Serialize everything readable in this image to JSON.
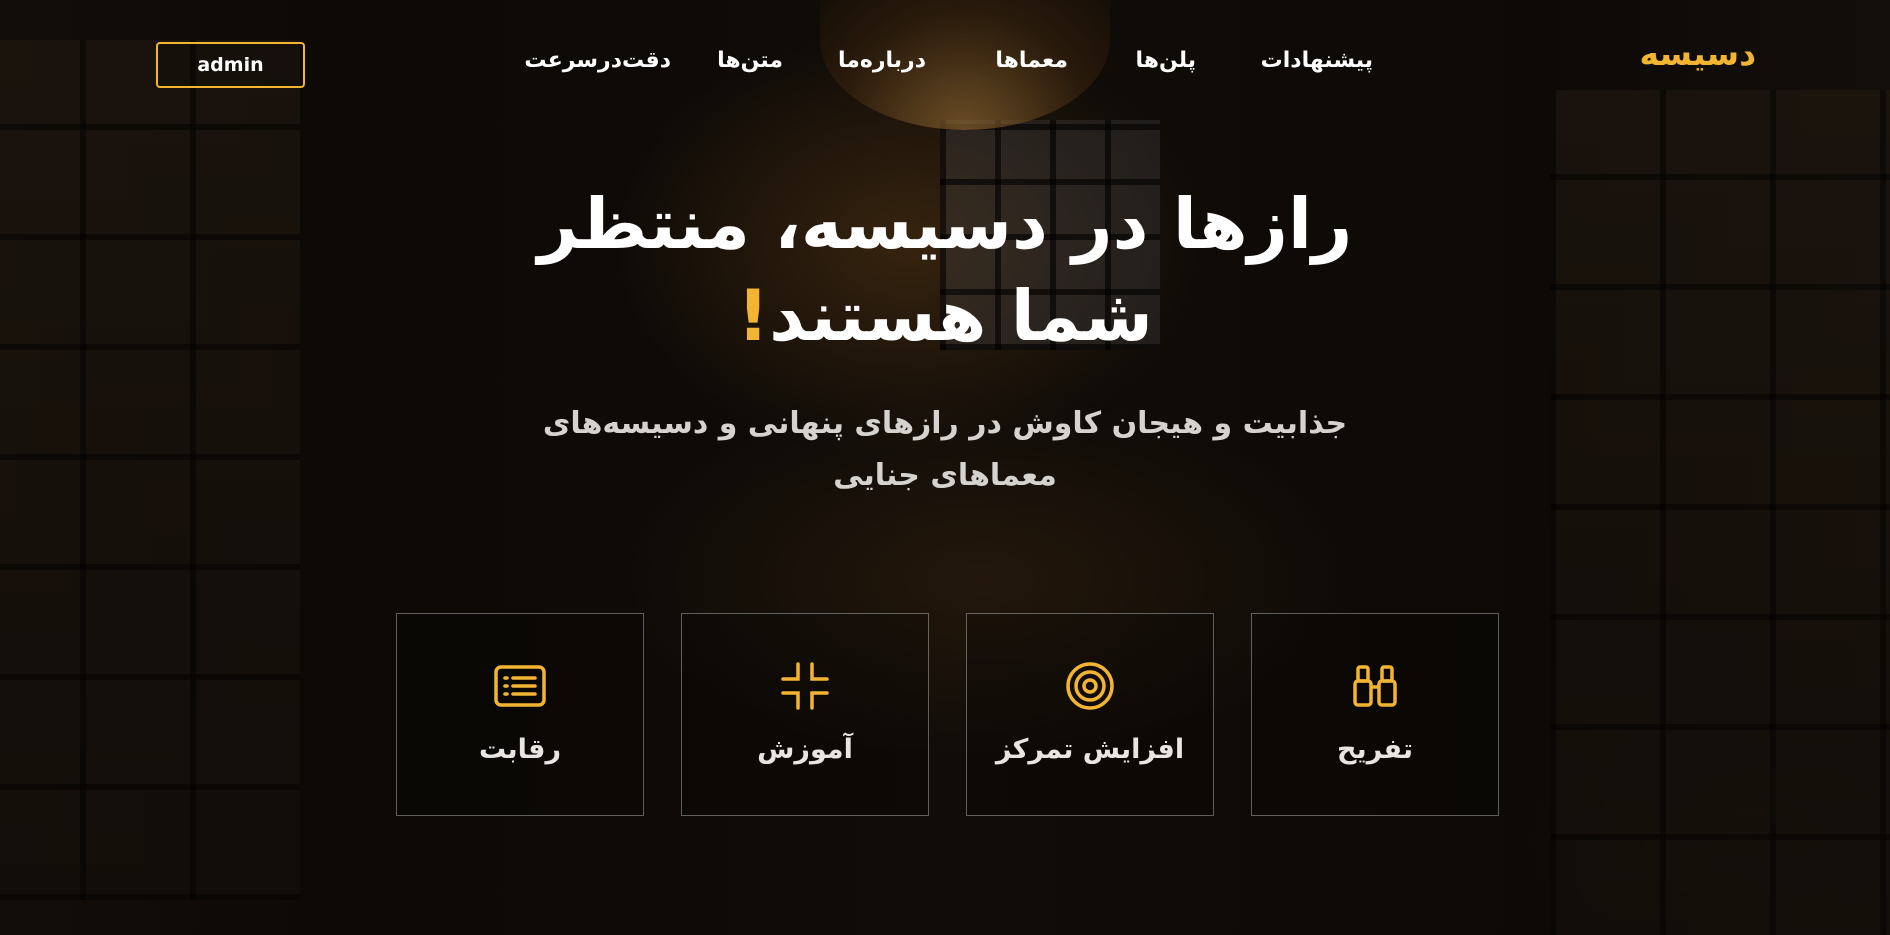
{
  "brand": {
    "logo_text": "دسیسه",
    "accent_color": "#f2b431"
  },
  "nav": {
    "items": [
      {
        "label": "پیشنهادات"
      },
      {
        "label": "پلن‌ها"
      },
      {
        "label": "معماها"
      },
      {
        "label": "درباره‌ما"
      },
      {
        "label": "متن‌ها"
      },
      {
        "label": "دقت‌در‌سرعت"
      }
    ],
    "admin_button": "admin"
  },
  "hero": {
    "title_line1": "رازها در دسیسه، منتظر",
    "title_line2": "شما هستند",
    "title_exclaim": "!",
    "subtitle_line1": "جذابیت و هیجان کاوش در رازهای پنهانی و دسیسه‌های",
    "subtitle_line2": "معماهای جنایی"
  },
  "features": [
    {
      "label": "تفریح",
      "icon": "binoculars-icon"
    },
    {
      "label": "افزایش تمرکز",
      "icon": "target-icon"
    },
    {
      "label": "آموزش",
      "icon": "compress-arrows-icon"
    },
    {
      "label": "رقابت",
      "icon": "list-icon"
    }
  ]
}
